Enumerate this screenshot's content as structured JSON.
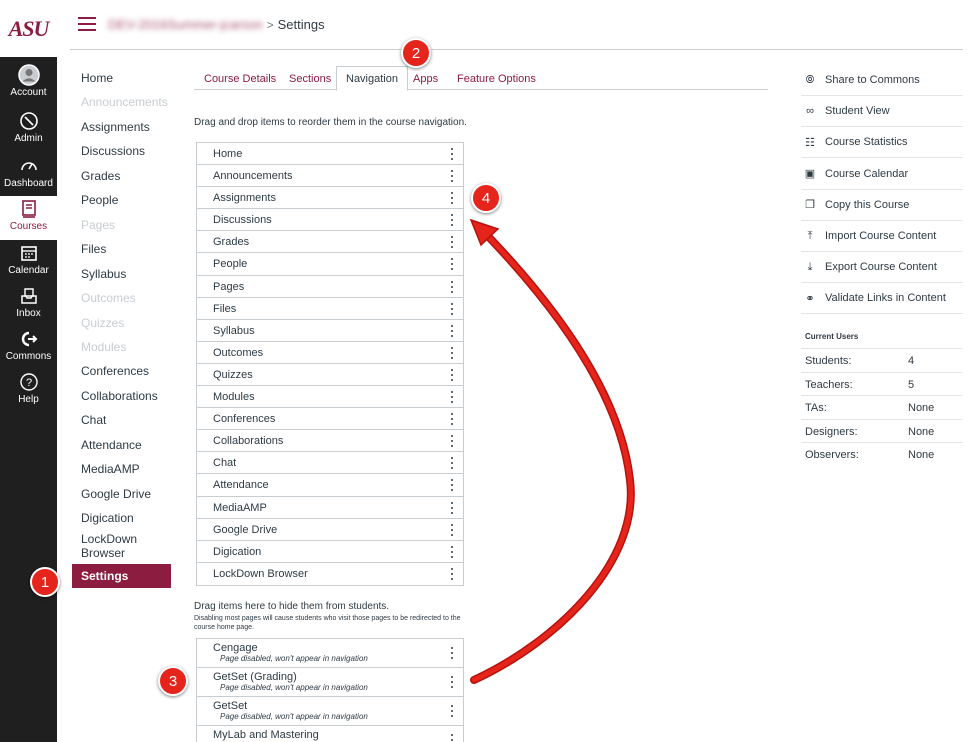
{
  "brand": {
    "logo_text": "ASU",
    "color": "#8c1d40"
  },
  "global_nav": [
    {
      "label": "Account",
      "icon": "account-icon"
    },
    {
      "label": "Admin",
      "icon": "shield-icon"
    },
    {
      "label": "Dashboard",
      "icon": "dashboard-icon"
    },
    {
      "label": "Courses",
      "icon": "courses-icon",
      "active": true
    },
    {
      "label": "Calendar",
      "icon": "calendar-icon"
    },
    {
      "label": "Inbox",
      "icon": "inbox-icon"
    },
    {
      "label": "Commons",
      "icon": "commons-icon"
    },
    {
      "label": "Help",
      "icon": "help-icon"
    }
  ],
  "breadcrumb": {
    "course": "DEV-2016Summer-jcarson",
    "separator": ">",
    "current": "Settings"
  },
  "course_nav": [
    {
      "label": "Home",
      "disabled": false
    },
    {
      "label": "Announcements",
      "disabled": true
    },
    {
      "label": "Assignments",
      "disabled": false
    },
    {
      "label": "Discussions",
      "disabled": false
    },
    {
      "label": "Grades",
      "disabled": false
    },
    {
      "label": "People",
      "disabled": false
    },
    {
      "label": "Pages",
      "disabled": true
    },
    {
      "label": "Files",
      "disabled": false
    },
    {
      "label": "Syllabus",
      "disabled": false
    },
    {
      "label": "Outcomes",
      "disabled": true
    },
    {
      "label": "Quizzes",
      "disabled": true
    },
    {
      "label": "Modules",
      "disabled": true
    },
    {
      "label": "Conferences",
      "disabled": false
    },
    {
      "label": "Collaborations",
      "disabled": false
    },
    {
      "label": "Chat",
      "disabled": false
    },
    {
      "label": "Attendance",
      "disabled": false
    },
    {
      "label": "MediaAMP",
      "disabled": false
    },
    {
      "label": "Google Drive",
      "disabled": false
    },
    {
      "label": "Digication",
      "disabled": false
    },
    {
      "label": "LockDown Browser",
      "disabled": false
    },
    {
      "label": "Settings",
      "active": true
    }
  ],
  "tabs": [
    "Course Details",
    "Sections",
    "Navigation",
    "Apps",
    "Feature Options"
  ],
  "active_tab": "Navigation",
  "instructions": {
    "drag_reorder": "Drag and drop items to reorder them in the course navigation.",
    "hide_title": "Drag items here to hide them from students.",
    "hide_note": "Disabling most pages will cause students who visit those pages to be redirected to the course home page."
  },
  "enabled_items": [
    "Home",
    "Announcements",
    "Assignments",
    "Discussions",
    "Grades",
    "People",
    "Pages",
    "Files",
    "Syllabus",
    "Outcomes",
    "Quizzes",
    "Modules",
    "Conferences",
    "Collaborations",
    "Chat",
    "Attendance",
    "MediaAMP",
    "Google Drive",
    "Digication",
    "LockDown Browser"
  ],
  "hidden_items": [
    {
      "name": "Cengage",
      "note": "Page disabled, won't appear in navigation"
    },
    {
      "name": "GetSet (Grading)",
      "note": "Page disabled, won't appear in navigation"
    },
    {
      "name": "GetSet",
      "note": "Page disabled, won't appear in navigation"
    },
    {
      "name": "MyLab and Mastering",
      "note": ""
    }
  ],
  "sidebar_links": [
    {
      "label": "Share to Commons",
      "icon": "share-icon"
    },
    {
      "label": "Student View",
      "icon": "glasses-icon"
    },
    {
      "label": "Course Statistics",
      "icon": "stats-icon"
    },
    {
      "label": "Course Calendar",
      "icon": "calendar-icon"
    },
    {
      "label": "Copy this Course",
      "icon": "copy-icon"
    },
    {
      "label": "Import Course Content",
      "icon": "import-icon"
    },
    {
      "label": "Export Course Content",
      "icon": "export-icon"
    },
    {
      "label": "Validate Links in Content",
      "icon": "link-icon"
    }
  ],
  "current_users": {
    "title": "Current Users",
    "rows": [
      {
        "role": "Students:",
        "count": "4"
      },
      {
        "role": "Teachers:",
        "count": "5"
      },
      {
        "role": "TAs:",
        "count": "None"
      },
      {
        "role": "Designers:",
        "count": "None"
      },
      {
        "role": "Observers:",
        "count": "None"
      }
    ]
  },
  "annotations": [
    "1",
    "2",
    "3",
    "4"
  ],
  "colors": {
    "accent": "#8c1d40",
    "annotation": "#e5241c",
    "nav_bg": "#1f1f1f",
    "border": "#c7cdd1"
  }
}
